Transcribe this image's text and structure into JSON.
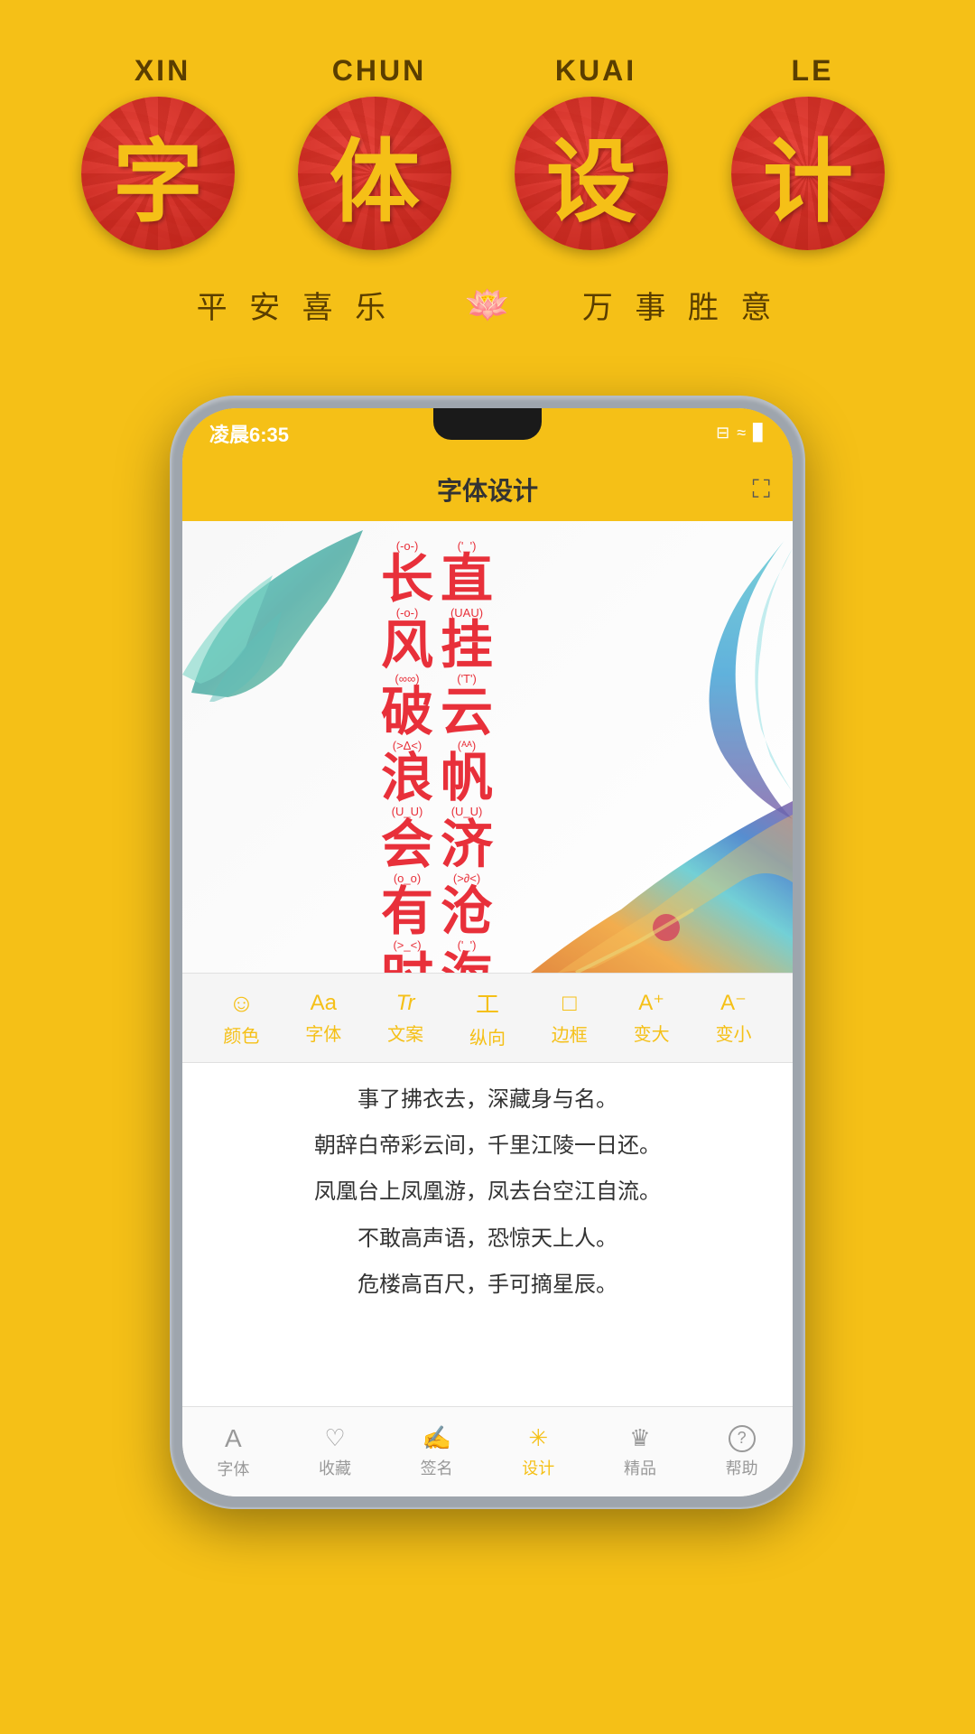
{
  "background_color": "#F5C017",
  "top": {
    "pinyin_labels": [
      "XIN",
      "CHUN",
      "KUAI",
      "LE"
    ],
    "chinese_chars": [
      "字",
      "体",
      "设",
      "计"
    ],
    "subtitle_left": "平 安 喜 乐",
    "subtitle_right": "万 事 胜 意"
  },
  "phone": {
    "status": {
      "time": "凌晨6:35",
      "icons": "⊟ ≈ ▊"
    },
    "header": {
      "title": "字体设计",
      "share_icon": "⛶"
    },
    "poem_display": {
      "lines": [
        {
          "col1": {
            "annotation": "(-o-)",
            "char": "长"
          },
          "col2": {
            "annotation": "('_')",
            "char": "直"
          }
        },
        {
          "col1": {
            "annotation": "(-o-)",
            "char": "风"
          },
          "col2": {
            "annotation": "(UAU)",
            "char": "挂"
          }
        },
        {
          "col1": {
            "annotation": "(∞∞)",
            "char": "破"
          },
          "col2": {
            "annotation": "('T')",
            "char": "云"
          }
        },
        {
          "col1": {
            "annotation": "(>Δ<)",
            "char": "浪"
          },
          "col2": {
            "annotation": "(ᴬᴬ)",
            "char": "帆"
          }
        },
        {
          "col1": {
            "annotation": "(U_U)",
            "char": "会"
          },
          "col2": {
            "annotation": "(U_U)",
            "char": "济"
          }
        },
        {
          "col1": {
            "annotation": "(o_o)",
            "char": "有"
          },
          "col2": {
            "annotation": "(>∂<)",
            "char": "沧"
          }
        },
        {
          "col1": {
            "annotation": "(>_<)",
            "char": "时"
          },
          "col2": {
            "annotation": "('_')",
            "char": "海"
          }
        }
      ]
    },
    "toolbar": {
      "items": [
        {
          "icon": "☺",
          "label": "颜色"
        },
        {
          "icon": "Aa",
          "label": "字体"
        },
        {
          "icon": "Tr",
          "label": "文案"
        },
        {
          "icon": "工",
          "label": "纵向"
        },
        {
          "icon": "□",
          "label": "边框"
        },
        {
          "icon": "A⁺",
          "label": "变大"
        },
        {
          "icon": "A⁻",
          "label": "变小"
        }
      ]
    },
    "text_lines": [
      "事了拂衣去，深藏身与名。",
      "朝辞白帝彩云间，千里江陵一日还。",
      "凤凰台上凤凰游，凤去台空江自流。",
      "不敢高声语，恐惊天上人。",
      "危楼高百尺，手可摘星辰。"
    ],
    "bottom_nav": {
      "items": [
        {
          "icon": "A",
          "label": "字体",
          "active": false
        },
        {
          "icon": "♡",
          "label": "收藏",
          "active": false
        },
        {
          "icon": "✍",
          "label": "签名",
          "active": false
        },
        {
          "icon": "✳",
          "label": "设计",
          "active": true
        },
        {
          "icon": "♛",
          "label": "精品",
          "active": false
        },
        {
          "icon": "?",
          "label": "帮助",
          "active": false
        }
      ]
    }
  }
}
